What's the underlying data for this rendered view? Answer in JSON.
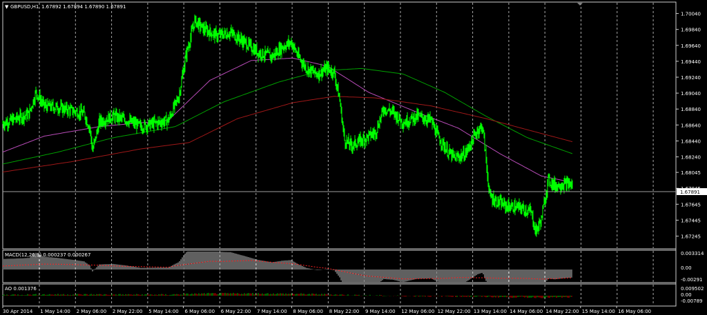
{
  "symbol_header": {
    "label": "GBPUSD,H1",
    "ohlc": "1.67892 1.67894 1.67890 1.67891"
  },
  "price_tag": "1.67891",
  "macd_header": "MACD(12,26,9) 0.000237 0.000267",
  "ao_header": "AO 0.001376",
  "price_scale": [
    "1.70040",
    "1.69840",
    "1.69640",
    "1.69440",
    "1.69240",
    "1.69040",
    "1.68840",
    "1.68640",
    "1.68440",
    "1.68240",
    "1.68045",
    "1.67845",
    "1.67645",
    "1.67445",
    "1.67245"
  ],
  "macd_scale": [
    "0.003314",
    "0.00",
    "-0.00291"
  ],
  "ao_scale": [
    "0.009502",
    "0.00",
    "-0.00789"
  ],
  "time_labels": [
    "30 Apr 2014",
    "1 May 14:00",
    "2 May 06:00",
    "2 May 22:00",
    "5 May 14:00",
    "6 May 06:00",
    "6 May 22:00",
    "7 May 14:00",
    "8 May 06:00",
    "8 May 22:00",
    "9 May 14:00",
    "12 May 06:00",
    "12 May 22:00",
    "13 May 14:00",
    "14 May 06:00",
    "14 May 22:00",
    "15 May 14:00",
    "16 May 06:00"
  ],
  "colors": {
    "background": "#000000",
    "candles": "#00ff00",
    "ma_fast": "#b84cb8",
    "ma_mid": "#00a000",
    "ma_slow": "#a01818",
    "grid": "#c8c8c8",
    "macd_hist": "#c0c0c0",
    "macd_signal": "#ff2020",
    "ao_up": "#00c000",
    "ao_down": "#e00000"
  },
  "chart_data": {
    "type": "candlestick",
    "symbol": "GBPUSD",
    "timeframe": "H1",
    "y_range": [
      1.6712,
      1.7014
    ],
    "bars": 825,
    "last_close": 1.67891,
    "close_path": [
      [
        0,
        1.6866
      ],
      [
        20,
        1.6872
      ],
      [
        38,
        1.6878
      ],
      [
        48,
        1.6905
      ],
      [
        60,
        1.6888
      ],
      [
        80,
        1.6886
      ],
      [
        100,
        1.6882
      ],
      [
        118,
        1.6878
      ],
      [
        126,
        1.686
      ],
      [
        130,
        1.6832
      ],
      [
        140,
        1.6868
      ],
      [
        160,
        1.6875
      ],
      [
        180,
        1.687
      ],
      [
        200,
        1.6862
      ],
      [
        220,
        1.6866
      ],
      [
        240,
        1.687
      ],
      [
        255,
        1.69
      ],
      [
        265,
        1.695
      ],
      [
        278,
        1.6995
      ],
      [
        290,
        1.6985
      ],
      [
        310,
        1.6976
      ],
      [
        330,
        1.698
      ],
      [
        350,
        1.6968
      ],
      [
        370,
        1.6955
      ],
      [
        390,
        1.695
      ],
      [
        405,
        1.6962
      ],
      [
        418,
        1.6968
      ],
      [
        428,
        1.695
      ],
      [
        440,
        1.6935
      ],
      [
        455,
        1.6928
      ],
      [
        470,
        1.6935
      ],
      [
        480,
        1.693
      ],
      [
        488,
        1.6895
      ],
      [
        495,
        1.6845
      ],
      [
        505,
        1.6838
      ],
      [
        520,
        1.6845
      ],
      [
        540,
        1.6855
      ],
      [
        552,
        1.6885
      ],
      [
        565,
        1.688
      ],
      [
        580,
        1.6867
      ],
      [
        600,
        1.6875
      ],
      [
        620,
        1.687
      ],
      [
        630,
        1.685
      ],
      [
        645,
        1.683
      ],
      [
        655,
        1.6822
      ],
      [
        670,
        1.6828
      ],
      [
        688,
        1.6858
      ],
      [
        695,
        1.6862
      ],
      [
        700,
        1.682
      ],
      [
        705,
        1.6775
      ],
      [
        715,
        1.6768
      ],
      [
        730,
        1.6762
      ],
      [
        750,
        1.676
      ],
      [
        765,
        1.6755
      ],
      [
        772,
        1.673
      ],
      [
        780,
        1.6745
      ],
      [
        790,
        1.6795
      ],
      [
        800,
        1.6788
      ],
      [
        815,
        1.679
      ],
      [
        825,
        1.6789
      ]
    ],
    "moving_averages": [
      {
        "color": "#b84cb8",
        "path": [
          [
            0,
            1.683
          ],
          [
            60,
            1.685
          ],
          [
            140,
            1.6862
          ],
          [
            240,
            1.687
          ],
          [
            300,
            1.692
          ],
          [
            360,
            1.6945
          ],
          [
            420,
            1.6948
          ],
          [
            470,
            1.6938
          ],
          [
            530,
            1.6905
          ],
          [
            600,
            1.688
          ],
          [
            660,
            1.686
          ],
          [
            720,
            1.6828
          ],
          [
            780,
            1.68
          ],
          [
            825,
            1.6792
          ]
        ]
      },
      {
        "color": "#00a000",
        "path": [
          [
            0,
            1.6815
          ],
          [
            80,
            1.683
          ],
          [
            160,
            1.6848
          ],
          [
            250,
            1.6862
          ],
          [
            320,
            1.6893
          ],
          [
            400,
            1.6918
          ],
          [
            460,
            1.6932
          ],
          [
            520,
            1.6935
          ],
          [
            580,
            1.6928
          ],
          [
            640,
            1.6905
          ],
          [
            700,
            1.6875
          ],
          [
            760,
            1.6848
          ],
          [
            825,
            1.6828
          ]
        ]
      },
      {
        "color": "#a01818",
        "path": [
          [
            0,
            1.6805
          ],
          [
            100,
            1.6818
          ],
          [
            200,
            1.6834
          ],
          [
            270,
            1.6842
          ],
          [
            340,
            1.6872
          ],
          [
            420,
            1.6892
          ],
          [
            480,
            1.69
          ],
          [
            540,
            1.6898
          ],
          [
            620,
            1.6888
          ],
          [
            700,
            1.6872
          ],
          [
            760,
            1.6858
          ],
          [
            825,
            1.6843
          ]
        ]
      }
    ],
    "macd_range": [
      -0.00291,
      0.003314
    ],
    "ao_range": [
      -0.00789,
      0.009502
    ],
    "price_axis_ticks": [
      1.7004,
      1.6984,
      1.6964,
      1.6944,
      1.6924,
      1.6904,
      1.6884,
      1.6864,
      1.6844,
      1.6824,
      1.68045,
      1.67845,
      1.67645,
      1.67445,
      1.67245
    ]
  }
}
